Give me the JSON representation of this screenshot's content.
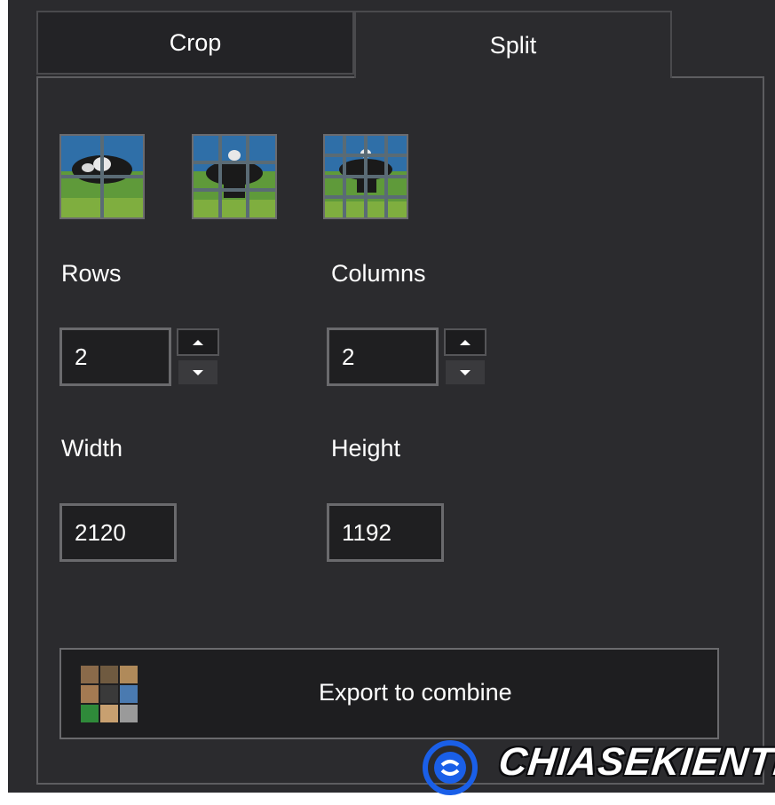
{
  "tabs": [
    {
      "label": "Crop",
      "active": false
    },
    {
      "label": "Split",
      "active": true
    }
  ],
  "presets": [
    {
      "icon": "grid-2x2-icon"
    },
    {
      "icon": "grid-3x3-icon"
    },
    {
      "icon": "grid-4x4-icon"
    }
  ],
  "rows": {
    "label": "Rows",
    "value": "2"
  },
  "columns": {
    "label": "Columns",
    "value": "2"
  },
  "width": {
    "label": "Width",
    "value": "2120"
  },
  "height": {
    "label": "Height",
    "value": "1192"
  },
  "export": {
    "label": "Export to combine",
    "icon": "image-grid-icon"
  },
  "watermark": {
    "text": "CHIASEKIENTHUC"
  },
  "colors": {
    "background": "#2b2b2e",
    "field_background": "#1f1f21",
    "border": "#6a6a6d",
    "text": "#ffffff",
    "watermark_blue": "#1a5fe8"
  }
}
